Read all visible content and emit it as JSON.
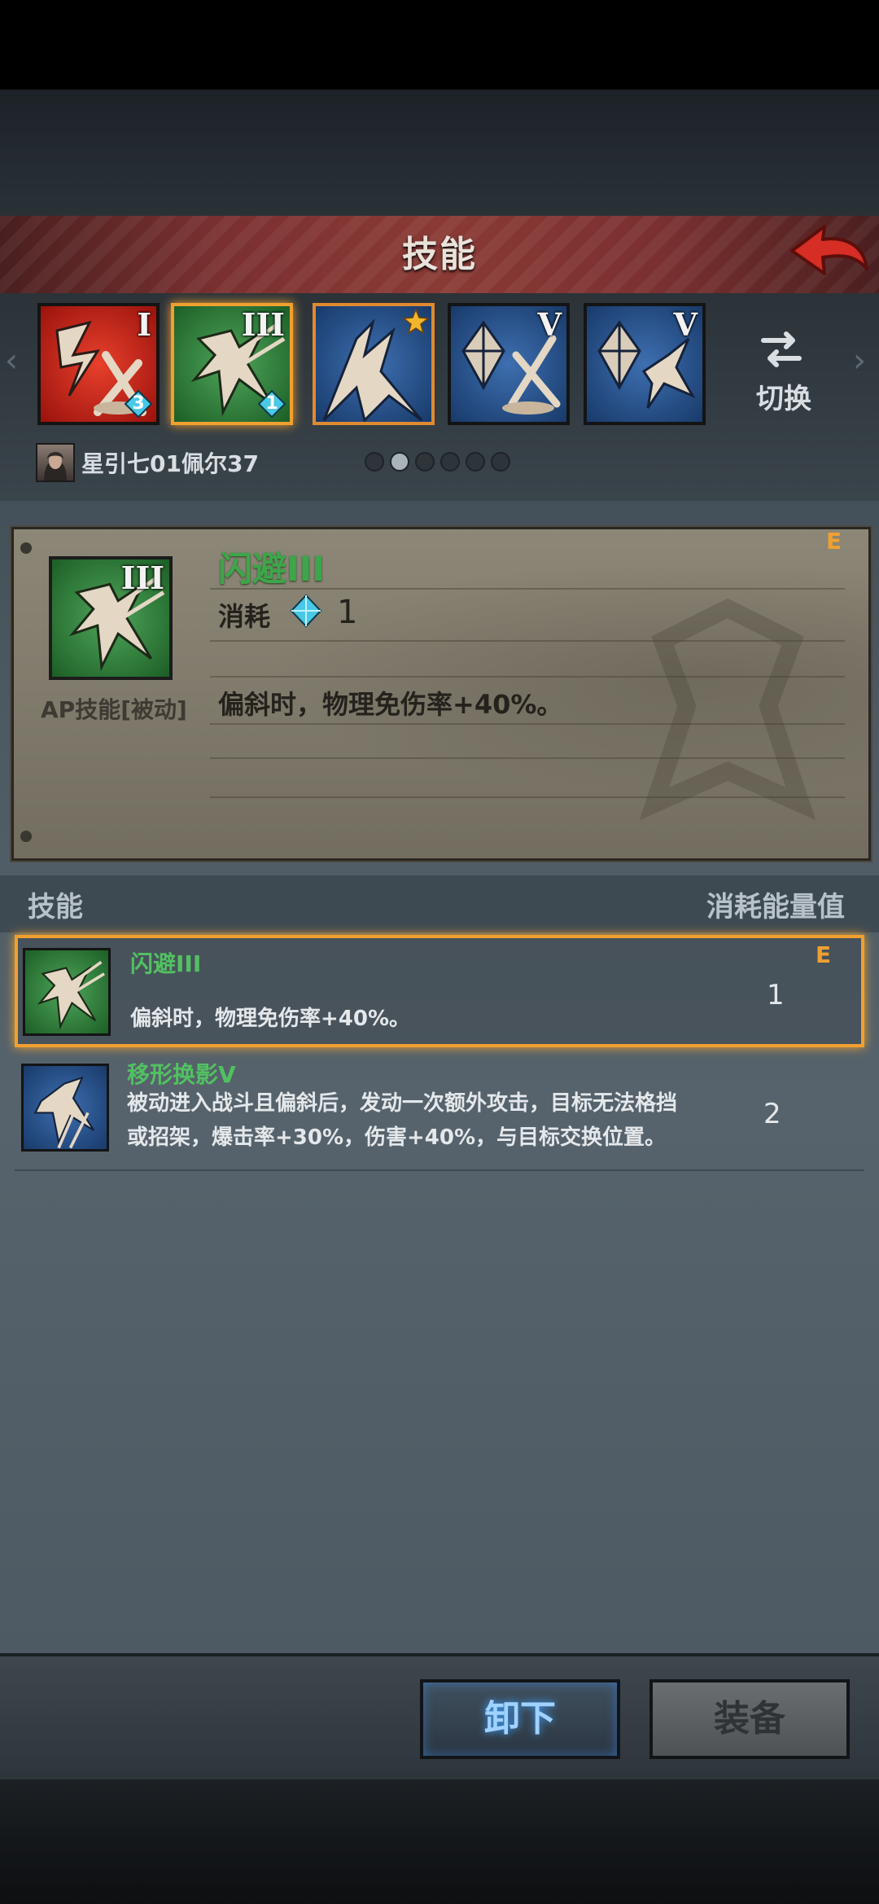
{
  "header": {
    "title": "技能"
  },
  "skill_slots": [
    {
      "name": "slot-1",
      "level": "I",
      "gem_count": "3",
      "color": "#c8211a"
    },
    {
      "name": "slot-2",
      "level": "III",
      "gem_count": "1",
      "color": "#2e8b3a"
    },
    {
      "name": "slot-3",
      "level": "",
      "gem_count": "",
      "color": "#24518e"
    },
    {
      "name": "slot-4",
      "level": "V",
      "gem_count": "",
      "color": "#24518e"
    },
    {
      "name": "slot-5",
      "level": "V",
      "gem_count": "",
      "color": "#24518e"
    }
  ],
  "switch": {
    "label": "切换"
  },
  "character": {
    "name": "星引七01佩尔37"
  },
  "page_dots": {
    "total": 6,
    "active": 2
  },
  "detail": {
    "level": "III",
    "tag": "E",
    "name": "闪避III",
    "cost_label": "消耗",
    "cost_value": "1",
    "type_label": "AP技能[被动]",
    "description": "偏斜时，物理免伤率+40%。"
  },
  "list": {
    "header_left": "技能",
    "header_right": "消耗能量值",
    "rows": [
      {
        "name": "闪避III",
        "desc": "偏斜时，物理免伤率+40%。",
        "cost": "1",
        "tag": "E"
      },
      {
        "name": "移形换影V",
        "desc_line1": "被动进入战斗且偏斜后，发动一次额外攻击，目标无法格挡",
        "desc_line2": "或招架，爆击率+30%，伤害+40%，与目标交换位置。",
        "cost": "2"
      }
    ]
  },
  "buttons": {
    "unequip": "卸下",
    "equip": "装备"
  },
  "colors": {
    "accent": "#f0a030",
    "skill_green": "#52c062",
    "gem": "#49c8e8"
  }
}
